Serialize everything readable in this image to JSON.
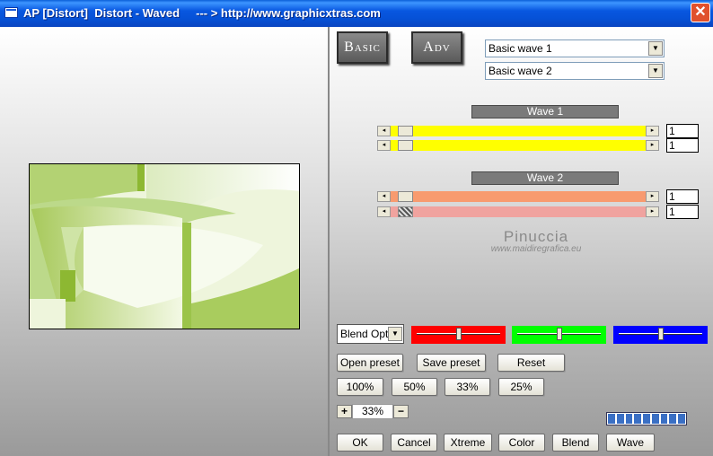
{
  "window": {
    "title": "AP [Distort]  Distort - Waved     --- > http://www.graphicxtras.com",
    "close_glyph": "✕"
  },
  "mode_buttons": {
    "basic": "Basic",
    "adv": "Adv"
  },
  "presets": {
    "wave1_select": "Basic wave 1",
    "wave2_select": "Basic wave 2"
  },
  "wave1": {
    "header": "Wave 1",
    "slider1_value": "1",
    "slider2_value": "1",
    "color": "#ffff00"
  },
  "wave2": {
    "header": "Wave 2",
    "slider1_value": "1",
    "slider2_value": "1",
    "color1": "#f89b6f",
    "color2": "#f0a39f"
  },
  "watermark": {
    "name": "Pinuccia",
    "url": "www.maidiregrafica.eu"
  },
  "blend": {
    "dropdown": "Blend Optio"
  },
  "color_sliders": {
    "red": {
      "color": "#ff0000",
      "level": 0.5
    },
    "green": {
      "color": "#00ff00",
      "level": 0.5
    },
    "blue": {
      "color": "#0000ff",
      "level": 0.5
    }
  },
  "preset_buttons": {
    "open": "Open preset",
    "save": "Save preset",
    "reset": "Reset"
  },
  "zoom_buttons": [
    "100%",
    "50%",
    "33%",
    "25%"
  ],
  "zoom": {
    "plus": "+",
    "minus": "−",
    "value": "33%"
  },
  "progress": {
    "segments": 9
  },
  "action_buttons": [
    "OK",
    "Cancel",
    "Xtreme",
    "Color",
    "Blend",
    "Wave"
  ]
}
